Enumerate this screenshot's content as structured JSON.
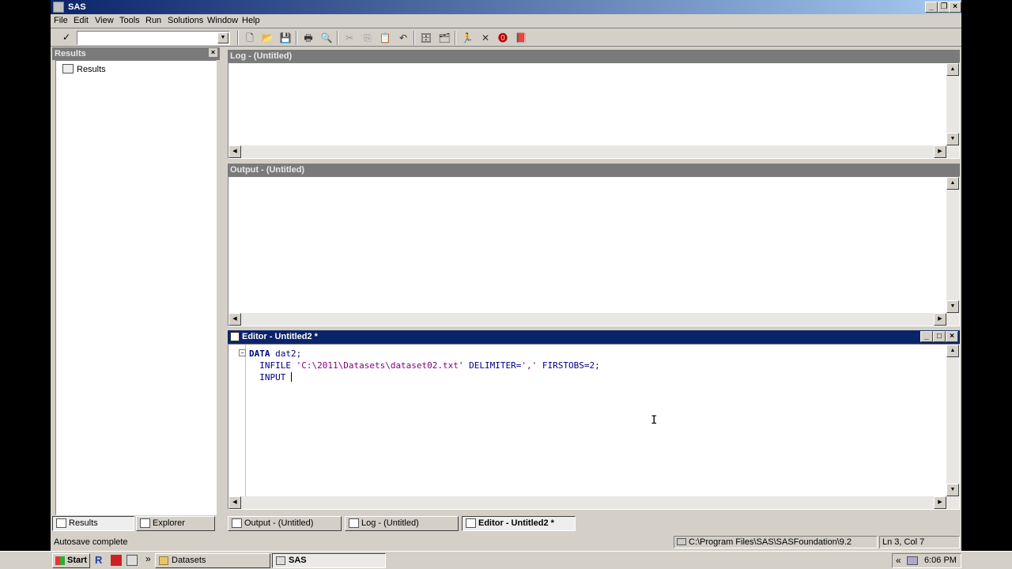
{
  "window": {
    "title": "SAS"
  },
  "menu": [
    "File",
    "Edit",
    "View",
    "Tools",
    "Run",
    "Solutions",
    "Window",
    "Help"
  ],
  "toolbar": {
    "command_value": "",
    "icons": [
      "new-icon",
      "open-icon",
      "save-icon",
      "print-icon",
      "print-preview-icon",
      "cut-icon",
      "copy-icon",
      "paste-icon",
      "undo-icon",
      "libraries-icon",
      "explorer-icon",
      "submit-icon",
      "clear-icon",
      "break-icon",
      "help-icon"
    ]
  },
  "results_pane": {
    "title": "Results",
    "tree": [
      "Results"
    ]
  },
  "log_pane": {
    "title": "Log - (Untitled)"
  },
  "output_pane": {
    "title": "Output - (Untitled)"
  },
  "editor_pane": {
    "title": "Editor - Untitled2 *",
    "lines": [
      {
        "kw": "DATA",
        "rest": " dat2;"
      },
      {
        "kw": "",
        "pre": "INFILE ",
        "str": "'C:\\2011\\Datasets\\dataset02.txt'",
        "mid": " DELIMITER=",
        "str2": "','",
        "post": " FIRSTOBS=2;"
      },
      {
        "kw": "",
        "pre": "INPUT ",
        "str": "",
        "mid": "",
        "str2": "",
        "post": ""
      }
    ]
  },
  "left_tabs": [
    "Results",
    "Explorer"
  ],
  "window_tabs": [
    "Output - (Untitled)",
    "Log - (Untitled)",
    "Editor - Untitled2 *"
  ],
  "status": {
    "message": "Autosave complete",
    "path": "C:\\Program Files\\SAS\\SASFoundation\\9.2",
    "position": "Ln 3, Col 7"
  },
  "taskbar": {
    "start": "Start",
    "tasks": [
      "Datasets",
      "SAS"
    ],
    "clock": "6:06 PM"
  }
}
